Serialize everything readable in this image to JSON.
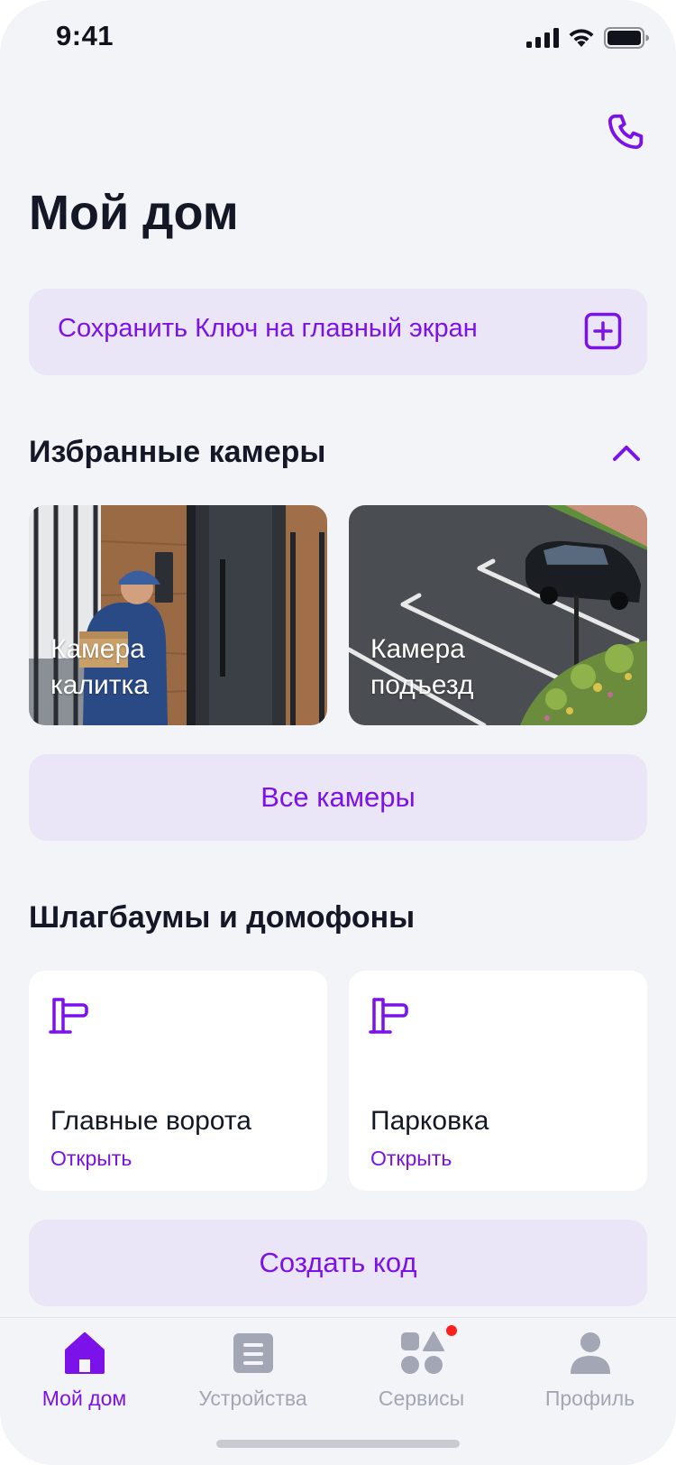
{
  "status_bar": {
    "time": "9:41"
  },
  "header": {
    "title": "Мой дом"
  },
  "banner": {
    "label": "Сохранить Ключ на главный экран"
  },
  "cameras": {
    "title": "Избранные камеры",
    "items": [
      {
        "label": "Камера\nкалитка"
      },
      {
        "label": "Камера\nподъезд"
      }
    ],
    "all_button": "Все камеры"
  },
  "barriers": {
    "title": "Шлагбаумы и домофоны",
    "items": [
      {
        "name": "Главные ворота",
        "action": "Открыть"
      },
      {
        "name": "Парковка",
        "action": "Открыть"
      }
    ],
    "create_button": "Создать код"
  },
  "tabbar": {
    "items": [
      {
        "label": "Мой дом",
        "icon": "home-icon",
        "active": true
      },
      {
        "label": "Устройства",
        "icon": "devices-icon",
        "active": false
      },
      {
        "label": "Сервисы",
        "icon": "services-icon",
        "active": false,
        "badge": true
      },
      {
        "label": "Профиль",
        "icon": "profile-icon",
        "active": false
      }
    ]
  },
  "colors": {
    "accent": "#7b12ea",
    "background": "#f3f4f8",
    "soft_accent": "#ebe6f7",
    "text": "#141826",
    "inactive": "#a3a6b4",
    "badge": "#ff1f1f"
  }
}
